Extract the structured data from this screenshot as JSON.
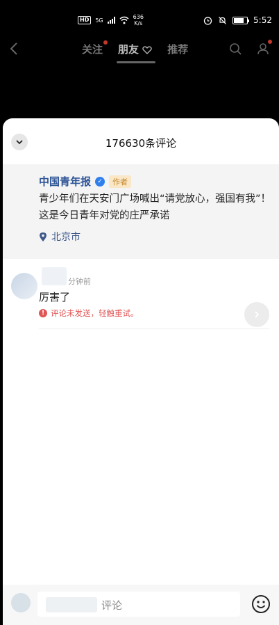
{
  "status_bar": {
    "network": "HD",
    "signal": "5G",
    "speed_value": "636",
    "speed_unit": "K/s",
    "time": "5:52"
  },
  "top_nav": {
    "tabs": [
      {
        "label": "关注"
      },
      {
        "label": "朋友"
      },
      {
        "label": "推荐"
      }
    ]
  },
  "sheet": {
    "comment_count": "176630条评论",
    "post": {
      "logo_text": "中国青年报",
      "author": "中国青年报",
      "author_tag": "作者",
      "text": "青少年们在天安门广场喊出“请党放心，强国有我”！这是今日青年对党的庄严承诺",
      "location": "北京市"
    },
    "comments": [
      {
        "time": "分钟前",
        "text": "厉害了",
        "status": "评论未发送，轻触重试。"
      }
    ],
    "input": {
      "placeholder": "评论"
    }
  },
  "colors": {
    "accent_blue": "#2e5497",
    "error_red": "#e05555",
    "tag_bg": "#f9e7c8"
  }
}
